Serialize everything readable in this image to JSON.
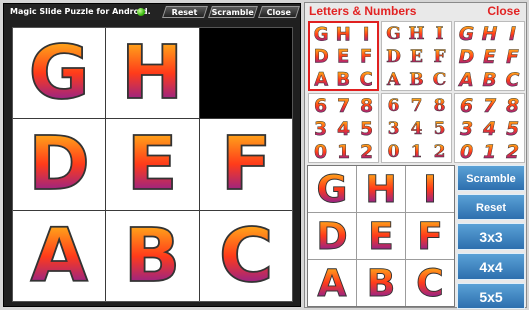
{
  "window": {
    "title": "Magic Slide Puzzle for Android.",
    "reset_label": "Reset",
    "scramble_label": "Scramble",
    "close_label": "Close"
  },
  "board": {
    "tiles": [
      "G",
      "H",
      "",
      "D",
      "E",
      "F",
      "A",
      "B",
      "C"
    ]
  },
  "chooser": {
    "title": "Letters & Numbers",
    "close_label": "Close",
    "puzzles": [
      [
        "G",
        "H",
        "I",
        "D",
        "E",
        "F",
        "A",
        "B",
        "C"
      ],
      [
        "G",
        "H",
        "I",
        "D",
        "E",
        "F",
        "A",
        "B",
        "C"
      ],
      [
        "G",
        "H",
        "I",
        "D",
        "E",
        "F",
        "A",
        "B",
        "C"
      ],
      [
        "6",
        "7",
        "8",
        "3",
        "4",
        "5",
        "0",
        "1",
        "2"
      ],
      [
        "6",
        "7",
        "8",
        "3",
        "4",
        "5",
        "0",
        "1",
        "2"
      ],
      [
        "6",
        "7",
        "8",
        "3",
        "4",
        "5",
        "0",
        "1",
        "2"
      ]
    ],
    "preview": [
      "G",
      "H",
      "I",
      "D",
      "E",
      "F",
      "A",
      "B",
      "C"
    ]
  },
  "sidebar": {
    "scramble_label": "Scramble",
    "reset_label": "Reset",
    "size_options": [
      "3x3",
      "4x4",
      "5x5"
    ]
  },
  "colors": {
    "gradient_top": "#ffd21a",
    "gradient_mid": "#ff3b1a",
    "gradient_bottom": "#5a14c8",
    "accent_red": "#e22323",
    "button_blue": "#3b82c4"
  }
}
